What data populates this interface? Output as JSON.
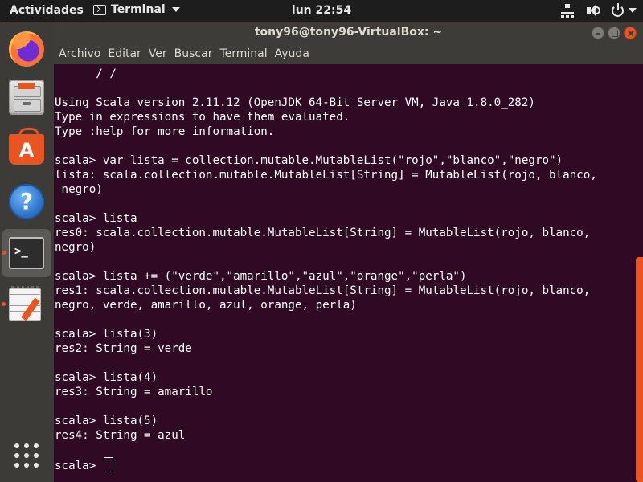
{
  "topbar": {
    "activities": "Actividades",
    "app_name": "Terminal",
    "clock": "lun 22:54",
    "tray_icons": [
      "network-icon",
      "volume-icon",
      "power-icon"
    ]
  },
  "dock": {
    "items": [
      {
        "name": "Firefox",
        "icon": "firefox-icon"
      },
      {
        "name": "Archivos",
        "icon": "files-icon"
      },
      {
        "name": "Ubuntu Software",
        "icon": "software-icon",
        "glyph": "A"
      },
      {
        "name": "Ayuda",
        "icon": "help-icon",
        "glyph": "?"
      },
      {
        "name": "Terminal",
        "icon": "terminal-icon",
        "glyph": ">_",
        "active": true
      },
      {
        "name": "Editor de texto",
        "icon": "text-editor-icon"
      }
    ],
    "accent": "#e95420"
  },
  "window": {
    "title": "tony96@tony96-VirtualBox: ~",
    "menu": [
      "Archivo",
      "Editar",
      "Ver",
      "Buscar",
      "Terminal",
      "Ayuda"
    ]
  },
  "terminal": {
    "lines": [
      "      /_/",
      "",
      "Using Scala version 2.11.12 (OpenJDK 64-Bit Server VM, Java 1.8.0_282)",
      "Type in expressions to have them evaluated.",
      "Type :help for more information.",
      "",
      "scala> var lista = collection.mutable.MutableList(\"rojo\",\"blanco\",\"negro\")",
      "lista: scala.collection.mutable.MutableList[String] = MutableList(rojo, blanco,",
      " negro)",
      "",
      "scala> lista",
      "res0: scala.collection.mutable.MutableList[String] = MutableList(rojo, blanco,",
      "negro)",
      "",
      "scala> lista += (\"verde\",\"amarillo\",\"azul\",\"orange\",\"perla\")",
      "res1: scala.collection.mutable.MutableList[String] = MutableList(rojo, blanco,",
      "negro, verde, amarillo, azul, orange, perla)",
      "",
      "scala> lista(3)",
      "res2: String = verde",
      "",
      "scala> lista(4)",
      "res3: String = amarillo",
      "",
      "scala> lista(5)",
      "res4: String = azul",
      ""
    ],
    "prompt": "scala> ",
    "background": "#300a24",
    "foreground": "#ffffff"
  }
}
